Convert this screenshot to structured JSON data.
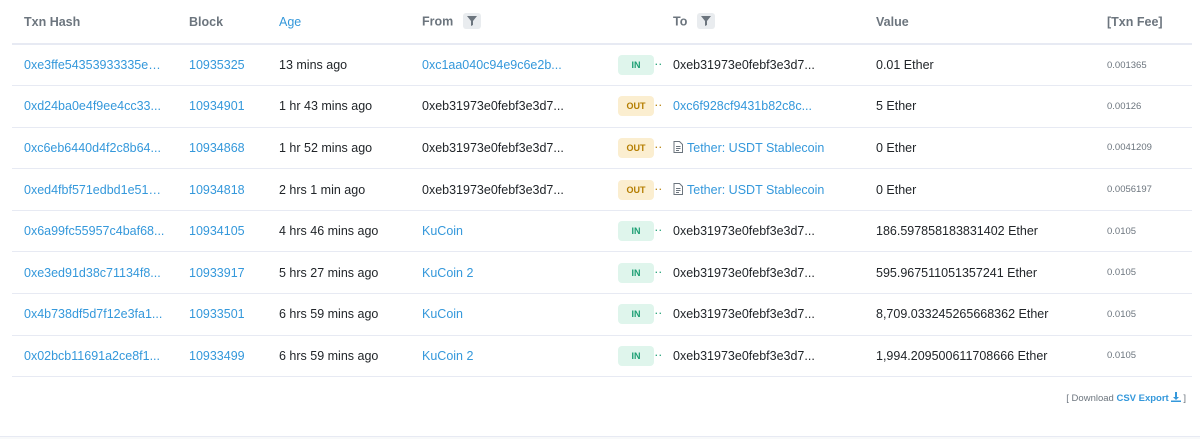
{
  "header": {
    "txn_hash": "Txn Hash",
    "block": "Block",
    "age": "Age",
    "from": "From",
    "to": "To",
    "value": "Value",
    "fee": "[Txn Fee]"
  },
  "rows": [
    {
      "hash": "0xe3ffe54353933335e3...",
      "block": "10935325",
      "age": "13 mins ago",
      "from": "0xc1aa040c94e9c6e2b...",
      "from_link": true,
      "dir": "IN",
      "to": "0xeb31973e0febf3e3d7...",
      "to_link": false,
      "to_contract": false,
      "value": "0.01 Ether",
      "fee": "0.001365"
    },
    {
      "hash": "0xd24ba0e4f9ee4cc33...",
      "block": "10934901",
      "age": "1 hr 43 mins ago",
      "from": "0xeb31973e0febf3e3d7...",
      "from_link": false,
      "dir": "OUT",
      "to": "0xc6f928cf9431b82c8c...",
      "to_link": true,
      "to_contract": false,
      "value": "5 Ether",
      "fee": "0.00126"
    },
    {
      "hash": "0xc6eb6440d4f2c8b64...",
      "block": "10934868",
      "age": "1 hr 52 mins ago",
      "from": "0xeb31973e0febf3e3d7...",
      "from_link": false,
      "dir": "OUT",
      "to": "Tether: USDT Stablecoin",
      "to_link": true,
      "to_contract": true,
      "value": "0 Ether",
      "fee": "0.0041209"
    },
    {
      "hash": "0xed4fbf571edbd1e510...",
      "block": "10934818",
      "age": "2 hrs 1 min ago",
      "from": "0xeb31973e0febf3e3d7...",
      "from_link": false,
      "dir": "OUT",
      "to": "Tether: USDT Stablecoin",
      "to_link": true,
      "to_contract": true,
      "value": "0 Ether",
      "fee": "0.0056197"
    },
    {
      "hash": "0x6a99fc55957c4baf68...",
      "block": "10934105",
      "age": "4 hrs 46 mins ago",
      "from": "KuCoin",
      "from_link": true,
      "dir": "IN",
      "to": "0xeb31973e0febf3e3d7...",
      "to_link": false,
      "to_contract": false,
      "value": "186.597858183831402 Ether",
      "fee": "0.0105"
    },
    {
      "hash": "0xe3ed91d38c71134f8...",
      "block": "10933917",
      "age": "5 hrs 27 mins ago",
      "from": "KuCoin 2",
      "from_link": true,
      "dir": "IN",
      "to": "0xeb31973e0febf3e3d7...",
      "to_link": false,
      "to_contract": false,
      "value": "595.967511051357241 Ether",
      "fee": "0.0105"
    },
    {
      "hash": "0x4b738df5d7f12e3fa1...",
      "block": "10933501",
      "age": "6 hrs 59 mins ago",
      "from": "KuCoin",
      "from_link": true,
      "dir": "IN",
      "to": "0xeb31973e0febf3e3d7...",
      "to_link": false,
      "to_contract": false,
      "value": "8,709.033245265668362 Ether",
      "fee": "0.0105"
    },
    {
      "hash": "0x02bcb11691a2ce8f1...",
      "block": "10933499",
      "age": "6 hrs 59 mins ago",
      "from": "KuCoin 2",
      "from_link": true,
      "dir": "IN",
      "to": "0xeb31973e0febf3e3d7...",
      "to_link": false,
      "to_contract": false,
      "value": "1,994.209500611708666 Ether",
      "fee": "0.0105"
    }
  ],
  "footer": {
    "prefix": "[ Download ",
    "csv": "CSV Export",
    "suffix": " ]"
  },
  "icons": {
    "filter": "filter-icon",
    "contract": "file-contract-icon",
    "download": "download-icon"
  },
  "colors": {
    "link": "#3498db",
    "in_bg": "#dff5ec",
    "in_fg": "#1a9e72",
    "out_bg": "#fbeed0",
    "out_fg": "#b47d00"
  }
}
